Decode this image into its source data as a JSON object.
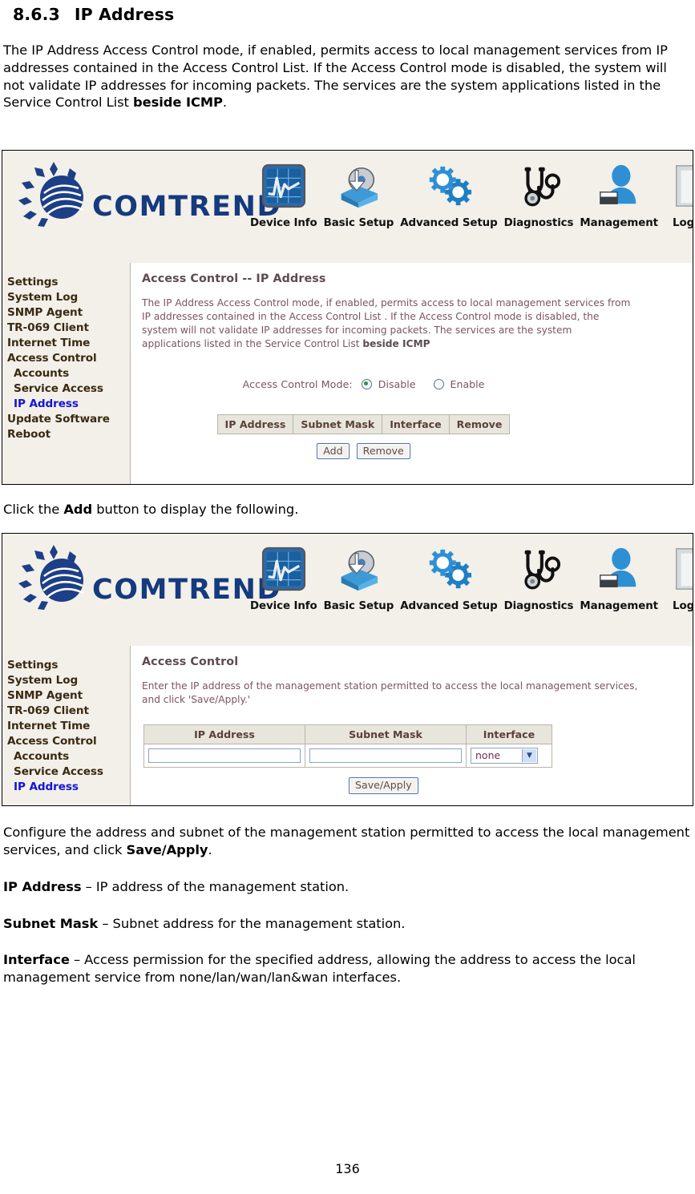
{
  "document": {
    "section_number": "8.6.3",
    "section_title": "IP Address",
    "intro_paragraph": "The IP Address Access Control mode, if enabled, permits access to local management services from IP addresses contained in the Access Control List. If the Access Control mode is disabled, the system will not validate IP addresses for incoming packets. The services are the system applications listed in the Service Control List ",
    "intro_bold": "beside ICMP",
    "intro_tail": ".",
    "click_add_prefix": "Click the ",
    "click_add_bold": "Add",
    "click_add_suffix": " button to display the following.",
    "configure_prefix": "Configure the address and subnet of the management station permitted to access the local management services, and click ",
    "configure_bold": "Save/Apply",
    "configure_suffix": ".",
    "def_ip_term": "IP Address",
    "def_ip_text": " – IP address of the management station.",
    "def_subnet_term": "Subnet Mask",
    "def_subnet_text": " – Subnet address for the management station.",
    "def_interface_term": "Interface",
    "def_interface_text": " – Access permission for the specified address, allowing the address to access the local management service from none/lan/wan/lan&wan interfaces.",
    "page_number": "136"
  },
  "brand": {
    "name": "COMTREND",
    "logo_color": "#153a7e"
  },
  "nav": {
    "items": [
      {
        "label": "Device Info",
        "icon": "device-info-icon"
      },
      {
        "label": "Basic Setup",
        "icon": "basic-setup-icon"
      },
      {
        "label": "Advanced Setup",
        "icon": "advanced-setup-icon"
      },
      {
        "label": "Diagnostics",
        "icon": "diagnostics-icon"
      },
      {
        "label": "Management",
        "icon": "management-icon"
      },
      {
        "label": "Logout",
        "icon": "logout-icon"
      }
    ]
  },
  "sidebar_full": {
    "items": [
      {
        "label": "Settings",
        "indent": false,
        "active": false
      },
      {
        "label": "System Log",
        "indent": false,
        "active": false
      },
      {
        "label": "SNMP Agent",
        "indent": false,
        "active": false
      },
      {
        "label": "TR-069 Client",
        "indent": false,
        "active": false
      },
      {
        "label": "Internet Time",
        "indent": false,
        "active": false
      },
      {
        "label": "Access Control",
        "indent": false,
        "active": false
      },
      {
        "label": "Accounts",
        "indent": true,
        "active": false
      },
      {
        "label": "Service Access",
        "indent": true,
        "active": false
      },
      {
        "label": "IP Address",
        "indent": true,
        "active": true
      },
      {
        "label": "Update Software",
        "indent": false,
        "active": false
      },
      {
        "label": "Reboot",
        "indent": false,
        "active": false
      }
    ]
  },
  "sidebar_short": {
    "items": [
      {
        "label": "Settings",
        "indent": false,
        "active": false
      },
      {
        "label": "System Log",
        "indent": false,
        "active": false
      },
      {
        "label": "SNMP Agent",
        "indent": false,
        "active": false
      },
      {
        "label": "TR-069 Client",
        "indent": false,
        "active": false
      },
      {
        "label": "Internet Time",
        "indent": false,
        "active": false
      },
      {
        "label": "Access Control",
        "indent": false,
        "active": false
      },
      {
        "label": "Accounts",
        "indent": true,
        "active": false
      },
      {
        "label": "Service Access",
        "indent": true,
        "active": false
      },
      {
        "label": "IP Address",
        "indent": true,
        "active": true
      }
    ]
  },
  "screen1": {
    "panel_title": "Access Control -- IP Address",
    "desc": "The IP Address Access Control mode, if enabled, permits access to local management services from IP addresses contained in the Access Control List . If the Access Control mode is disabled, the system will not validate IP addresses for incoming packets. The services are the system applications listed in the Service Control List ",
    "desc_bold": "beside ICMP",
    "mode_label": "Access Control Mode:",
    "option_disable": "Disable",
    "option_enable": "Enable",
    "selected_mode": "Disable",
    "table_headers": [
      "IP Address",
      "Subnet Mask",
      "Interface",
      "Remove"
    ],
    "table_rows": [],
    "buttons": {
      "add": "Add",
      "remove": "Remove"
    }
  },
  "screen2": {
    "panel_title": "Access Control",
    "desc": "Enter the IP address of the management station permitted to access the local management services, and click 'Save/Apply.'",
    "table_headers": [
      "IP Address",
      "Subnet Mask",
      "Interface"
    ],
    "ip_value": "",
    "subnet_value": "",
    "interface_value": "none",
    "interface_options": [
      "none",
      "lan",
      "wan",
      "lan&wan"
    ],
    "buttons": {
      "save_apply": "Save/Apply"
    }
  }
}
